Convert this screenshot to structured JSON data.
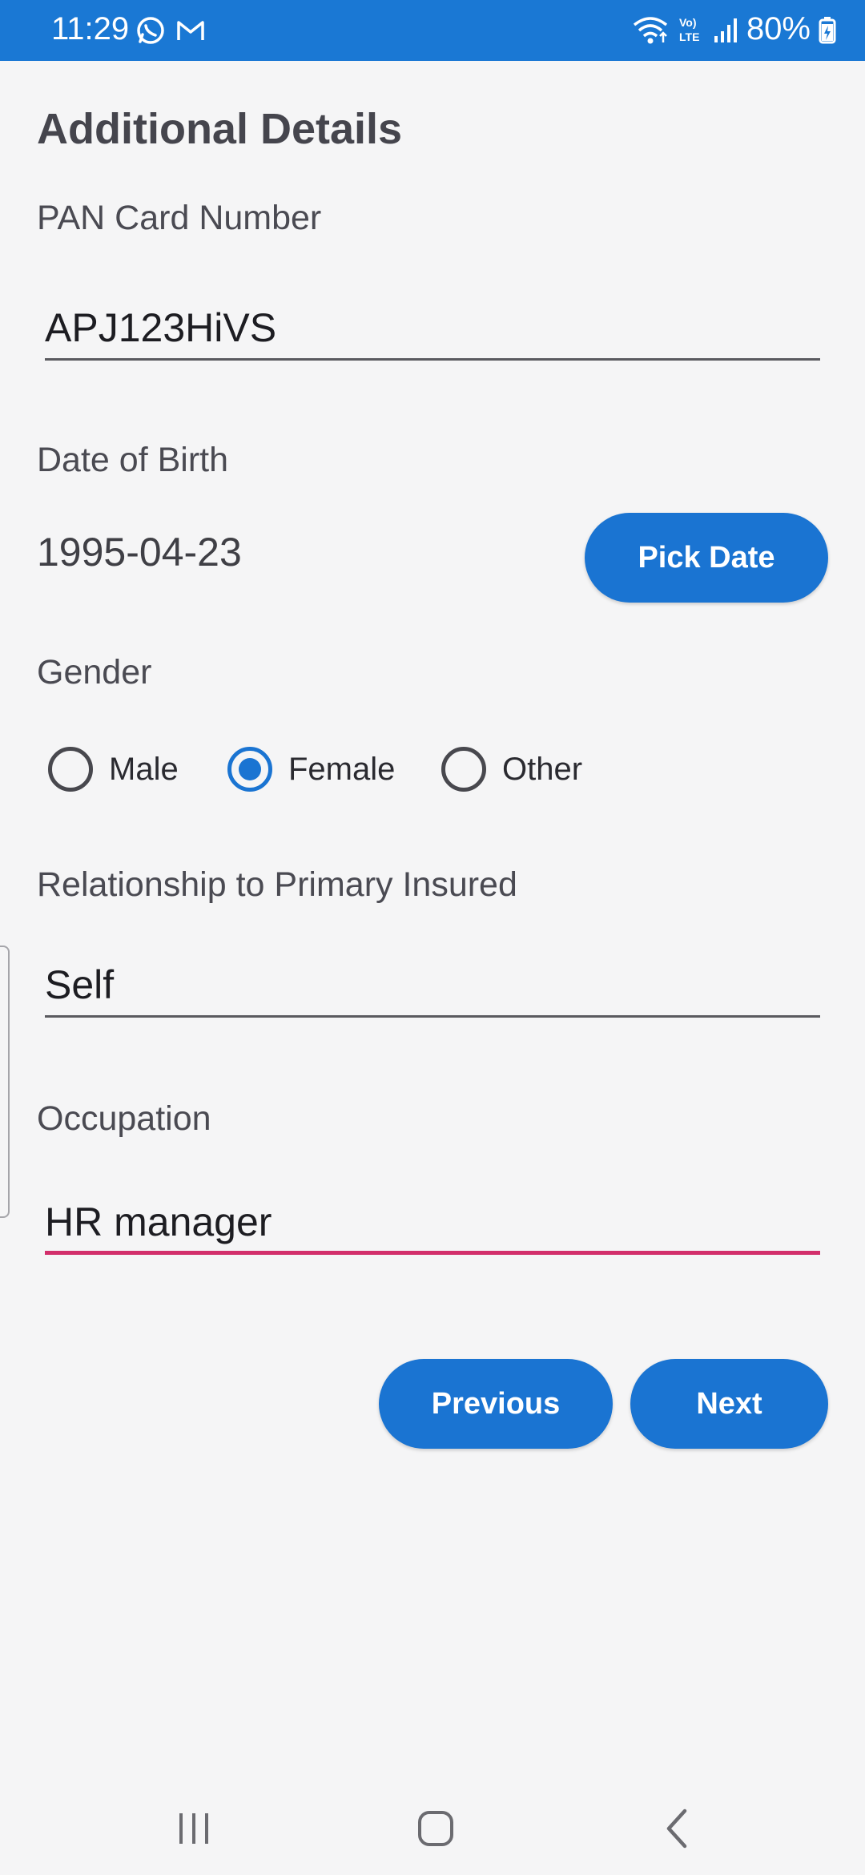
{
  "status_bar": {
    "time": "11:29",
    "battery": "80%",
    "icons": [
      "whatsapp-icon",
      "gmail-icon",
      "wifi-icon",
      "volte-icon",
      "signal-icon",
      "battery-charging-icon"
    ]
  },
  "form": {
    "title": "Additional Details",
    "pan": {
      "label": "PAN Card Number",
      "value": "APJ123HiVS"
    },
    "dob": {
      "label": "Date of Birth",
      "value": "1995-04-23",
      "button": "Pick Date"
    },
    "gender": {
      "label": "Gender",
      "options": [
        {
          "label": "Male",
          "checked": false
        },
        {
          "label": "Female",
          "checked": true
        },
        {
          "label": "Other",
          "checked": false
        }
      ]
    },
    "relationship": {
      "label": "Relationship to Primary Insured",
      "value": "Self"
    },
    "occupation": {
      "label": "Occupation",
      "value": "HR manager"
    },
    "buttons": {
      "previous": "Previous",
      "next": "Next"
    }
  },
  "nav_bar": {
    "icons": [
      "recent-apps-icon",
      "home-icon",
      "back-icon"
    ]
  },
  "colors": {
    "primary": "#1a74d2",
    "status_bar": "#1a78d4",
    "focus_underline": "#d22f6b",
    "background": "#f5f5f6"
  }
}
